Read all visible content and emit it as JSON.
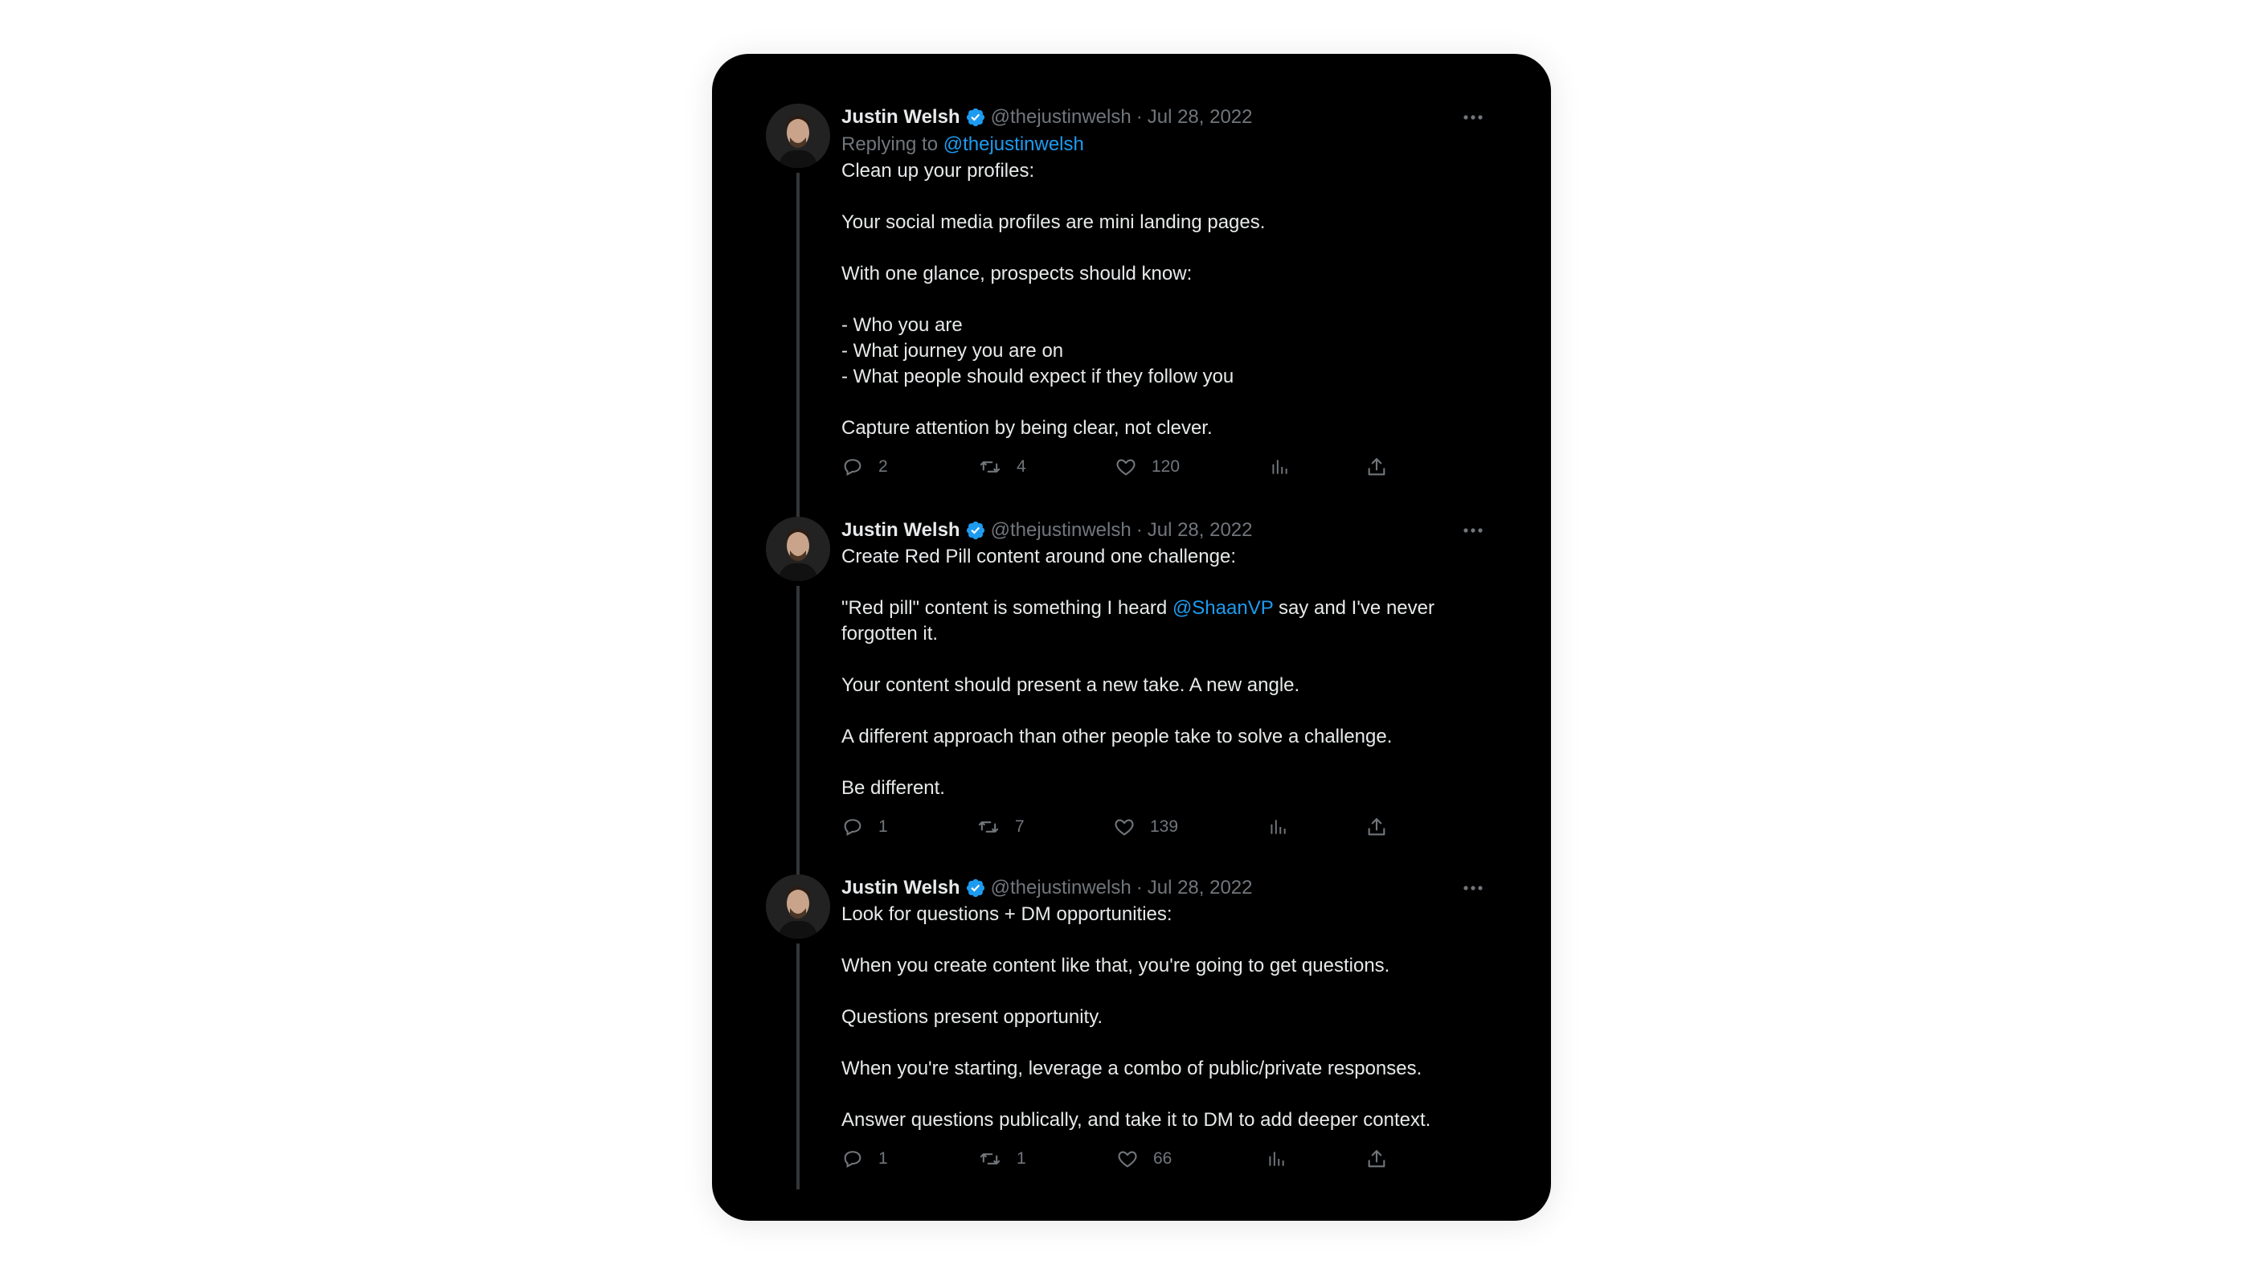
{
  "tweets": [
    {
      "author": "Justin Welsh",
      "handle": "@thejustinwelsh",
      "separator": "·",
      "date": "Jul 28, 2022",
      "replying_prefix": "Replying to ",
      "replying_to": "@thejustinwelsh",
      "lines": {
        "l1": "Clean up your profiles:",
        "l2": "Your social media profiles are mini landing pages.",
        "l3": "With one glance, prospects should know:",
        "l4": "- Who you are",
        "l5": "- What journey you are on",
        "l6": "- What people should expect if they follow you",
        "l7": "Capture attention by being clear, not clever."
      },
      "replies": "2",
      "retweets": "4",
      "likes": "120"
    },
    {
      "author": "Justin Welsh",
      "handle": "@thejustinwelsh",
      "separator": "·",
      "date": "Jul 28, 2022",
      "lines": {
        "l1": "Create Red Pill content around one challenge:",
        "l2a": "\"Red pill\" content is something I heard ",
        "l2mention": "@ShaanVP",
        "l2b": " say and I've never",
        "l2c": "forgotten it.",
        "l3": "Your content should present a new take. A new angle.",
        "l4": "A different approach than other people take to solve a challenge.",
        "l5": "Be different."
      },
      "replies": "1",
      "retweets": "7",
      "likes": "139"
    },
    {
      "author": "Justin Welsh",
      "handle": "@thejustinwelsh",
      "separator": "·",
      "date": "Jul 28, 2022",
      "lines": {
        "l1": "Look for questions + DM opportunities:",
        "l2": "When you create content like that, you're going to get questions.",
        "l3": "Questions present opportunity.",
        "l4": "When you're starting, leverage a combo of public/private responses.",
        "l5": "Answer questions publically, and take it to DM to add deeper context."
      },
      "replies": "1",
      "retweets": "1",
      "likes": "66"
    }
  ],
  "colors": {
    "background": "#000000",
    "text": "#e7e9ea",
    "muted": "#71767b",
    "link": "#1d9bf0",
    "verified": "#1d9bf0",
    "thread_line": "#333639"
  },
  "icons": [
    "verified-badge-icon",
    "more-icon",
    "reply-icon",
    "retweet-icon",
    "like-icon",
    "views-icon",
    "share-icon"
  ]
}
